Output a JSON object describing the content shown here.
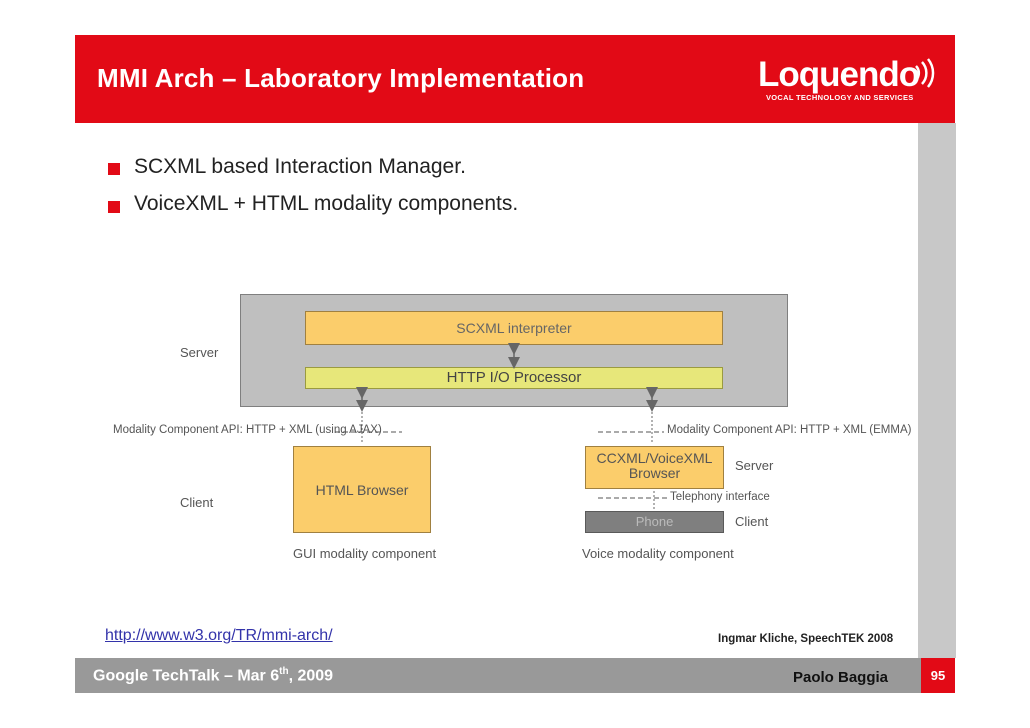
{
  "header": {
    "title": "MMI Arch – Laboratory Implementation",
    "logo_word": "Loquendo",
    "logo_tagline": "VOCAL TECHNOLOGY AND SERVICES"
  },
  "bullets": [
    "SCXML based Interaction Manager.",
    "VoiceXML + HTML modality components."
  ],
  "diagram": {
    "server_label": "Server",
    "scxml_interpreter": "SCXML interpreter",
    "http_processor": "HTTP I/O Processor",
    "api_left": "Modality Component API: HTTP + XML (using AJAX)",
    "api_right": "Modality Component API: HTTP + XML (EMMA)",
    "html_browser": "HTML Browser",
    "client_label": "Client",
    "ccxml_browser": "CCXML/VoiceXML Browser",
    "voice_server_label": "Server",
    "telephony": "Telephony interface",
    "phone": "Phone",
    "voice_client_label": "Client",
    "gui_component": "GUI modality component",
    "voice_component": "Voice modality component"
  },
  "footer": {
    "link": "http://www.w3.org/TR/mmi-arch/",
    "credit": "Ingmar Kliche, SpeechTEK 2008",
    "event_prefix": "Google TechTalk – Mar 6",
    "event_sup": "th",
    "event_suffix": ", 2009",
    "author": "Paolo Baggia",
    "page_number": "95"
  },
  "colors": {
    "brand_red": "#e20a16",
    "component_yellow": "#fbcd6b",
    "http_green_yellow": "#e7e77a",
    "footer_gray": "#999999"
  }
}
